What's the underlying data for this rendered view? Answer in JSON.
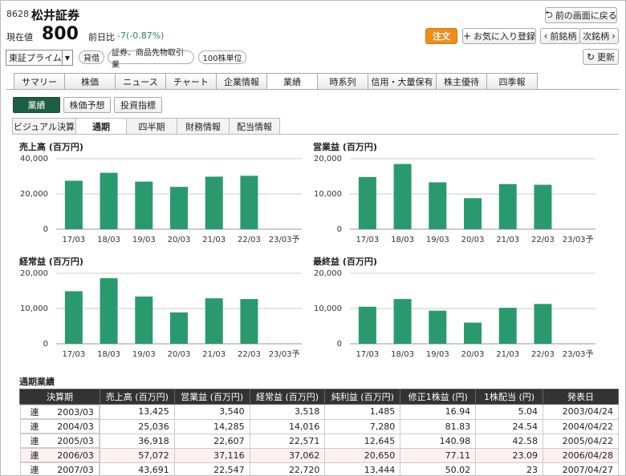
{
  "header": {
    "code": "8628",
    "name": "松井証券",
    "back_label": "前の画面に戻る",
    "price_label": "現在値",
    "price": "800",
    "change_label": "前日比",
    "change": "-7(-0.87%)",
    "order_label": "注文",
    "fav_label": "お気に入り登録",
    "prev_label": "前銘柄",
    "next_label": "次銘柄",
    "refresh_label": "更新",
    "market": "東証プライム",
    "tags": [
      "貸借",
      "証券、商品先物取引業",
      "100株単位"
    ]
  },
  "tabs": [
    "サマリー",
    "株価",
    "ニュース",
    "チャート",
    "企業情報",
    "業績",
    "時系列",
    "信用・大量保有",
    "株主優待",
    "四季報"
  ],
  "active_tab": 5,
  "subtabs": [
    "業績",
    "株価予想",
    "投資指標"
  ],
  "active_subtab": 0,
  "tabs2": [
    "ビジュアル決算",
    "通期",
    "四半期",
    "財務情報",
    "配当情報"
  ],
  "active_tab2": 1,
  "chart_color": "#2a9a6e",
  "chart_data": [
    {
      "type": "bar",
      "title": "売上高 (百万円)",
      "categories": [
        "17/03",
        "18/03",
        "19/03",
        "20/03",
        "21/03",
        "22/03",
        "23/03予"
      ],
      "values": [
        27500,
        32000,
        27000,
        24000,
        29800,
        30300,
        null
      ],
      "yticks": [
        "40,000",
        "20,000",
        "0"
      ],
      "ylim": [
        0,
        40000
      ],
      "grid": true
    },
    {
      "type": "bar",
      "title": "営業益 (百万円)",
      "categories": [
        "17/03",
        "18/03",
        "19/03",
        "20/03",
        "21/03",
        "22/03",
        "23/03予"
      ],
      "values": [
        14800,
        18500,
        13300,
        8800,
        12800,
        12600,
        null
      ],
      "yticks": [
        "20,000",
        "10,000",
        "0"
      ],
      "ylim": [
        0,
        20000
      ],
      "grid": true
    },
    {
      "type": "bar",
      "title": "経常益 (百万円)",
      "categories": [
        "17/03",
        "18/03",
        "19/03",
        "20/03",
        "21/03",
        "22/03",
        "23/03予"
      ],
      "values": [
        14900,
        18600,
        13400,
        8900,
        12900,
        12700,
        null
      ],
      "yticks": [
        "20,000",
        "10,000",
        "0"
      ],
      "ylim": [
        0,
        20000
      ],
      "grid": true
    },
    {
      "type": "bar",
      "title": "最終益 (百万円)",
      "categories": [
        "17/03",
        "18/03",
        "19/03",
        "20/03",
        "21/03",
        "22/03",
        "23/03予"
      ],
      "values": [
        10500,
        12700,
        9400,
        6000,
        10200,
        11300,
        null
      ],
      "yticks": [
        "20,000",
        "10,000",
        "0"
      ],
      "ylim": [
        0,
        20000
      ],
      "grid": true
    }
  ],
  "table": {
    "title": "通期業績",
    "headers": [
      "決算期",
      "売上高 (百万円)",
      "営業益 (百万円)",
      "経常益 (百万円)",
      "純利益 (百万円)",
      "修正1株益 (円)",
      "1株配当 (円)",
      "発表日"
    ],
    "rows": [
      [
        "連",
        "2003/03",
        "13,425",
        "3,540",
        "3,518",
        "1,485",
        "16.94",
        "5.04",
        "2003/04/24"
      ],
      [
        "連",
        "2004/03",
        "25,036",
        "14,285",
        "14,016",
        "7,280",
        "81.83",
        "24.54",
        "2004/04/22"
      ],
      [
        "連",
        "2005/03",
        "36,918",
        "22,607",
        "22,571",
        "12,645",
        "140.98",
        "42.58",
        "2005/04/22"
      ],
      [
        "連",
        "2006/03",
        "57,072",
        "37,116",
        "37,062",
        "20,650",
        "77.11",
        "23.09",
        "2006/04/28"
      ],
      [
        "連",
        "2007/03",
        "43,691",
        "22,547",
        "22,720",
        "13,444",
        "50.02",
        "23",
        "2007/04/27"
      ]
    ],
    "highlight_row": 3
  }
}
